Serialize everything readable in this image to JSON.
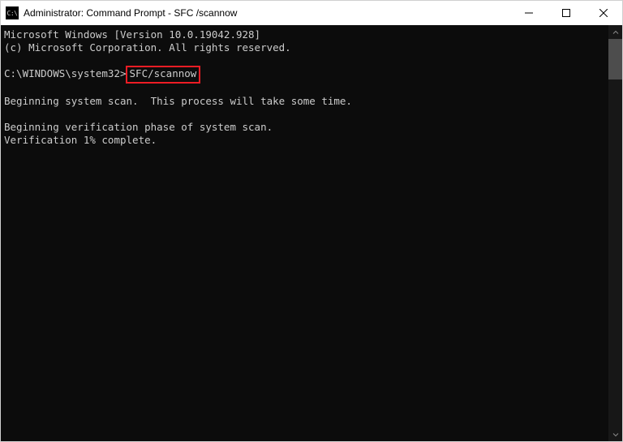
{
  "titlebar": {
    "icon_label": "C:\\",
    "title": "Administrator: Command Prompt - SFC /scannow"
  },
  "terminal": {
    "line_version": "Microsoft Windows [Version 10.0.19042.928]",
    "line_copyright": "(c) Microsoft Corporation. All rights reserved.",
    "prompt_prefix": "C:\\WINDOWS\\system32>",
    "command": "SFC/scannow",
    "line_scan_begin": "Beginning system scan.  This process will take some time.",
    "line_verification": "Beginning verification phase of system scan.",
    "line_progress": "Verification 1% complete."
  }
}
